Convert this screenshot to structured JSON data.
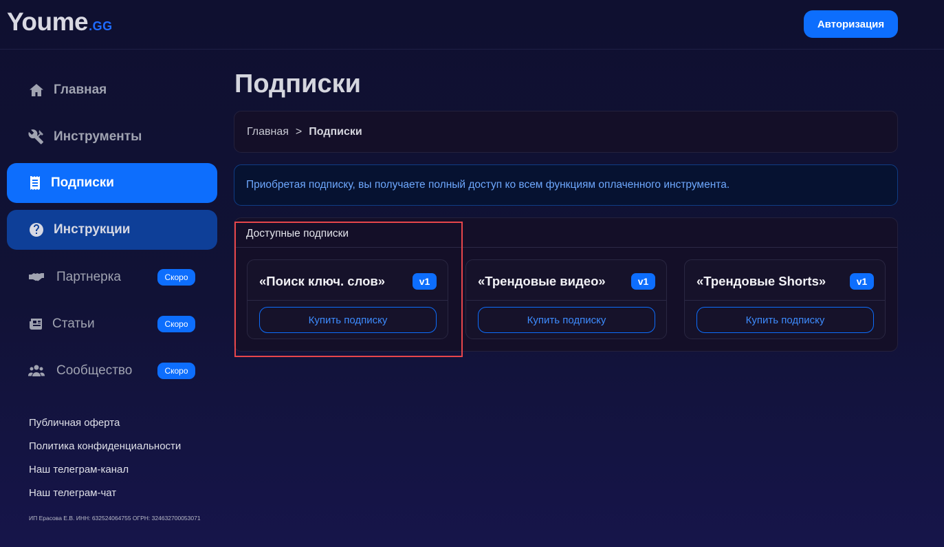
{
  "header": {
    "logo_main": "Youme",
    "logo_tld": ".GG",
    "auth_button": "Авторизация"
  },
  "sidebar": {
    "items": [
      {
        "label": "Главная",
        "icon": "home-icon",
        "state": "normal"
      },
      {
        "label": "Инструменты",
        "icon": "tools-icon",
        "state": "normal"
      },
      {
        "label": "Подписки",
        "icon": "receipt-icon",
        "state": "active"
      },
      {
        "label": "Инструкции",
        "icon": "question-circle-icon",
        "state": "hover"
      },
      {
        "label": "Партнерка",
        "icon": "handshake-icon",
        "state": "soon",
        "badge": "Скоро"
      },
      {
        "label": "Статьи",
        "icon": "newspaper-icon",
        "state": "soon",
        "badge": "Скоро"
      },
      {
        "label": "Сообщество",
        "icon": "users-icon",
        "state": "soon",
        "badge": "Скоро"
      }
    ],
    "footer_links": [
      "Публичная оферта",
      "Политика конфиденциальности",
      "Наш телеграм-канал",
      "Наш телеграм-чат"
    ],
    "legal": "ИП Ерасова Е.В. ИНН: 632524064755 ОГРН: 324632700053071"
  },
  "main": {
    "title": "Подписки",
    "breadcrumb": {
      "home": "Главная",
      "separator": ">",
      "current": "Подписки"
    },
    "info": "Приобретая подписку, вы получаете полный доступ ко всем функциям оплаченного инструмента.",
    "subscriptions": {
      "header": "Доступные подписки",
      "cards": [
        {
          "title": "«Поиск ключ. слов»",
          "version": "v1",
          "button": "Купить подписку"
        },
        {
          "title": "«Трендовые видео»",
          "version": "v1",
          "button": "Купить подписку"
        },
        {
          "title": "«Трендовые Shorts»",
          "version": "v1",
          "button": "Купить подписку"
        }
      ]
    }
  },
  "colors": {
    "accent": "#0d6efd",
    "background": "#111236",
    "highlight": "#e8464b",
    "info_text": "#6ea8fe"
  }
}
